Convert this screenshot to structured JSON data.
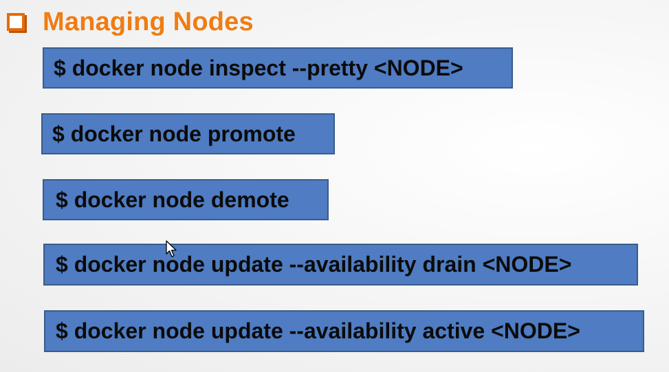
{
  "slide": {
    "title": "Managing Nodes",
    "title_color": "#f07c12",
    "bullet_icon": "checkbox-bullet-icon"
  },
  "commands": [
    "$ docker node inspect --pretty <NODE>",
    "$ docker node promote",
    "$ docker node demote",
    "$ docker node update --availability drain <NODE>",
    "$ docker node update --availability active <NODE>"
  ],
  "colors": {
    "box_fill": "#4f7cc2",
    "box_border": "#385d8a",
    "command_text": "#0b0b0b"
  },
  "cursor_icon": "mouse-pointer-icon"
}
